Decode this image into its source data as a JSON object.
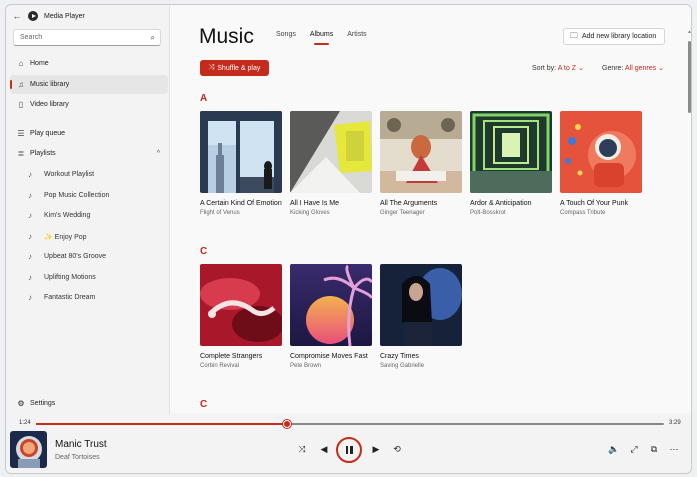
{
  "app": {
    "title": "Media Player"
  },
  "search": {
    "placeholder": "Search"
  },
  "nav": {
    "home": "Home",
    "music_library": "Music library",
    "video_library": "Video library",
    "play_queue": "Play queue",
    "playlists": "Playlists",
    "settings": "Settings"
  },
  "playlists": [
    "Workout Playlist",
    "Pop Music Collection",
    "Kim's Wedding",
    "✨ Enjoy Pop",
    "Upbeat 80's Groove",
    "Uplifting Motions",
    "Fantastic Dream"
  ],
  "header": {
    "title": "Music",
    "tabs": [
      "Songs",
      "Albums",
      "Artists"
    ],
    "active_tab": "Albums",
    "add_library": "Add new library location",
    "shuffle_play": "Shuffle & play",
    "sort_label": "Sort by:",
    "sort_value": "A to Z",
    "genre_label": "Genre:",
    "genre_value": "All genres"
  },
  "sections": [
    {
      "letter": "A",
      "albums": [
        {
          "title": "A Certain Kind Of Emotion",
          "artist": "Flight of Venus"
        },
        {
          "title": "All I Have Is Me",
          "artist": "Kicking Gloves"
        },
        {
          "title": "All The Arguments",
          "artist": "Ginger Teenager"
        },
        {
          "title": "Ardor & Anticipation",
          "artist": "Polt-Bosskrot"
        },
        {
          "title": "A Touch Of Your Punk",
          "artist": "Compass Tribute"
        }
      ]
    },
    {
      "letter": "C",
      "albums": [
        {
          "title": "Complete Strangers",
          "artist": "Corbin Revival"
        },
        {
          "title": "Compromise Moves Fast",
          "artist": "Pete Brown"
        },
        {
          "title": "Crazy Times",
          "artist": "Saving Gabrielle"
        }
      ]
    },
    {
      "letter": "C",
      "albums": []
    }
  ],
  "player": {
    "elapsed": "1:24",
    "total": "3:29",
    "progress_fraction": 0.4,
    "track": "Manic Trust",
    "artist": "Deaf Tortoises"
  },
  "colors": {
    "accent": "#c42b1c"
  },
  "icons": {
    "back": "back-arrow-icon",
    "shuffle": "shuffle-icon",
    "previous": "previous-icon",
    "pause": "pause-icon",
    "next": "next-icon",
    "repeat": "repeat-icon",
    "volume": "volume-icon",
    "fullscreen": "expand-icon",
    "miniplayer": "miniplayer-icon",
    "more": "more-icon"
  }
}
